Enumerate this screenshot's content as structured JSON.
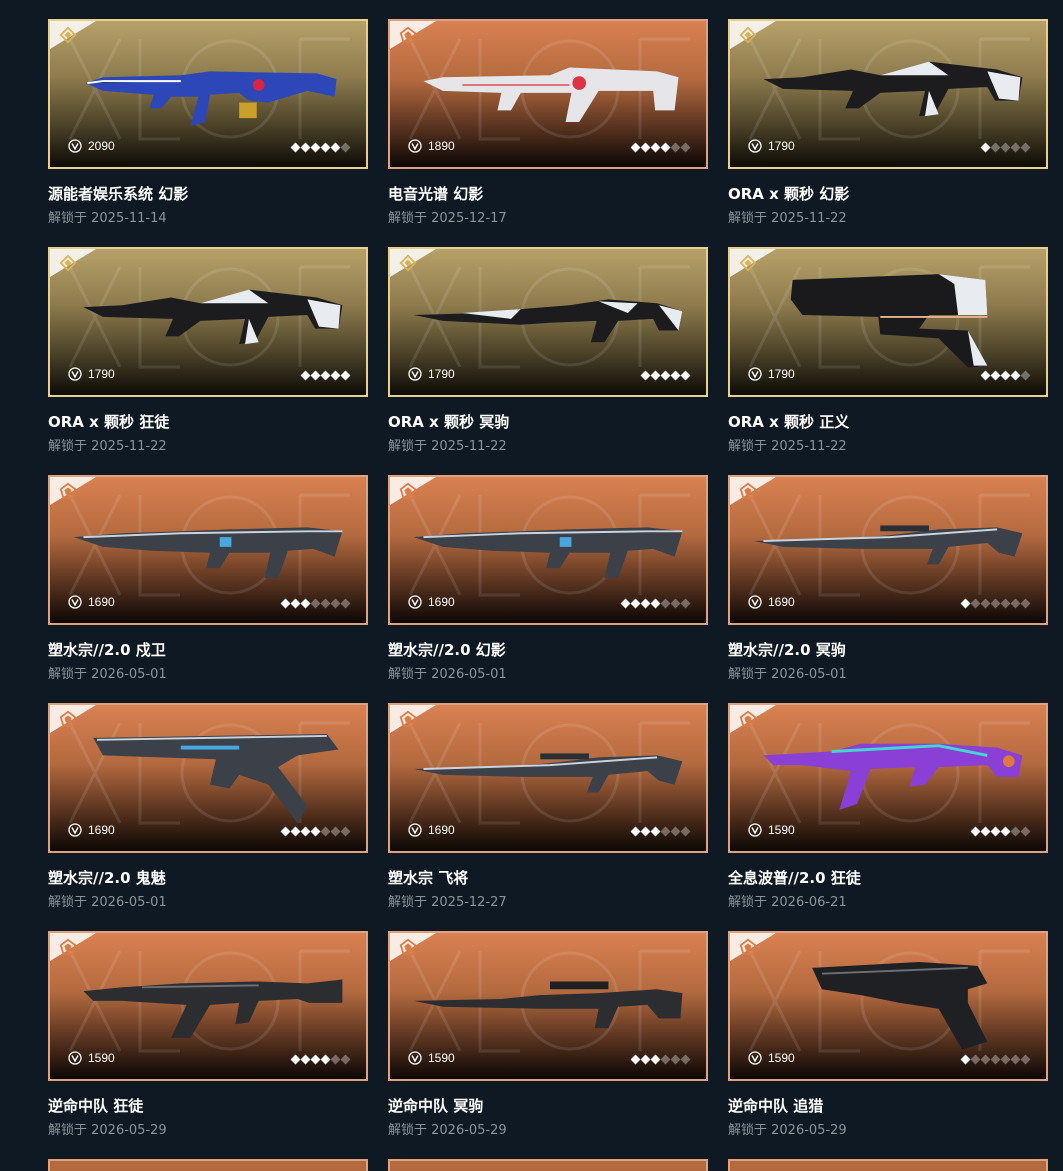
{
  "colors": {
    "background": "#0f1923",
    "gold_tier_border": "#e8cf8a",
    "orange_tier_border": "#e0a27c",
    "date_text": "#8b939b"
  },
  "icons": {
    "price": "vp-currency-icon",
    "tier_gold": "diamond-tier-icon",
    "tier_orange": "pentagon-tier-icon"
  },
  "skins": [
    {
      "name": "源能者娱乐系统 幻影",
      "date": "解锁于 2025-11-14",
      "price": "2090",
      "tier": "gold",
      "stars": 5,
      "stars_total": 6,
      "weapon": "blue-rifle"
    },
    {
      "name": "电音光谱 幻影",
      "date": "解锁于 2025-12-17",
      "price": "1890",
      "tier": "orange",
      "stars": 4,
      "stars_total": 6,
      "weapon": "white-rifle"
    },
    {
      "name": "ORA x 颗秒 幻影",
      "date": "解锁于 2025-11-22",
      "price": "1790",
      "tier": "gold",
      "stars": 1,
      "stars_total": 5,
      "weapon": "bw-rifle"
    },
    {
      "name": "ORA x 颗秒 狂徒",
      "date": "解锁于 2025-11-22",
      "price": "1790",
      "tier": "gold",
      "stars": 5,
      "stars_total": 5,
      "weapon": "bw-rifle"
    },
    {
      "name": "ORA x 颗秒 冥驹",
      "date": "解锁于 2025-11-22",
      "price": "1790",
      "tier": "gold",
      "stars": 5,
      "stars_total": 5,
      "weapon": "bw-sniper"
    },
    {
      "name": "ORA x 颗秒 正义",
      "date": "解锁于 2025-11-22",
      "price": "1790",
      "tier": "gold",
      "stars": 4,
      "stars_total": 5,
      "weapon": "bw-pistol"
    },
    {
      "name": "塑水宗//2.0 戍卫",
      "date": "解锁于 2026-05-01",
      "price": "1690",
      "tier": "orange",
      "stars": 3,
      "stars_total": 7,
      "weapon": "steel-rifle"
    },
    {
      "name": "塑水宗//2.0 幻影",
      "date": "解锁于 2026-05-01",
      "price": "1690",
      "tier": "orange",
      "stars": 4,
      "stars_total": 7,
      "weapon": "steel-rifle"
    },
    {
      "name": "塑水宗//2.0 冥驹",
      "date": "解锁于 2026-05-01",
      "price": "1690",
      "tier": "orange",
      "stars": 1,
      "stars_total": 7,
      "weapon": "steel-sniper"
    },
    {
      "name": "塑水宗//2.0 鬼魅",
      "date": "解锁于 2026-05-01",
      "price": "1690",
      "tier": "orange",
      "stars": 4,
      "stars_total": 7,
      "weapon": "steel-pistol"
    },
    {
      "name": "塑水宗 飞将",
      "date": "解锁于 2025-12-27",
      "price": "1690",
      "tier": "orange",
      "stars": 3,
      "stars_total": 6,
      "weapon": "steel-sniper"
    },
    {
      "name": "全息波普//2.0 狂徒",
      "date": "解锁于 2026-06-21",
      "price": "1590",
      "tier": "orange",
      "stars": 4,
      "stars_total": 6,
      "weapon": "holo-rifle"
    },
    {
      "name": "逆命中队 狂徒",
      "date": "解锁于 2026-05-29",
      "price": "1590",
      "tier": "orange",
      "stars": 4,
      "stars_total": 6,
      "weapon": "dark-rifle"
    },
    {
      "name": "逆命中队 冥驹",
      "date": "解锁于 2026-05-29",
      "price": "1590",
      "tier": "orange",
      "stars": 3,
      "stars_total": 6,
      "weapon": "dark-sniper"
    },
    {
      "name": "逆命中队 追猎",
      "date": "解锁于 2026-05-29",
      "price": "1590",
      "tier": "orange",
      "stars": 1,
      "stars_total": 7,
      "weapon": "dark-pistol"
    }
  ]
}
